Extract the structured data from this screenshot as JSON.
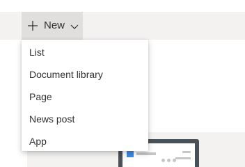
{
  "command_bar": {
    "new_button": {
      "label": "New",
      "icon": "plus-icon",
      "dropdown_icon": "chevron-down-icon"
    }
  },
  "menu": {
    "items": [
      {
        "label": "List"
      },
      {
        "label": "Document library"
      },
      {
        "label": "Page"
      },
      {
        "label": "News post"
      },
      {
        "label": "App"
      }
    ]
  },
  "colors": {
    "command_bar_bg": "#f3f2f1",
    "button_pressed_bg": "#e1dfdd",
    "text": "#323130",
    "thumbnail_accent": "#3b8ae6"
  }
}
